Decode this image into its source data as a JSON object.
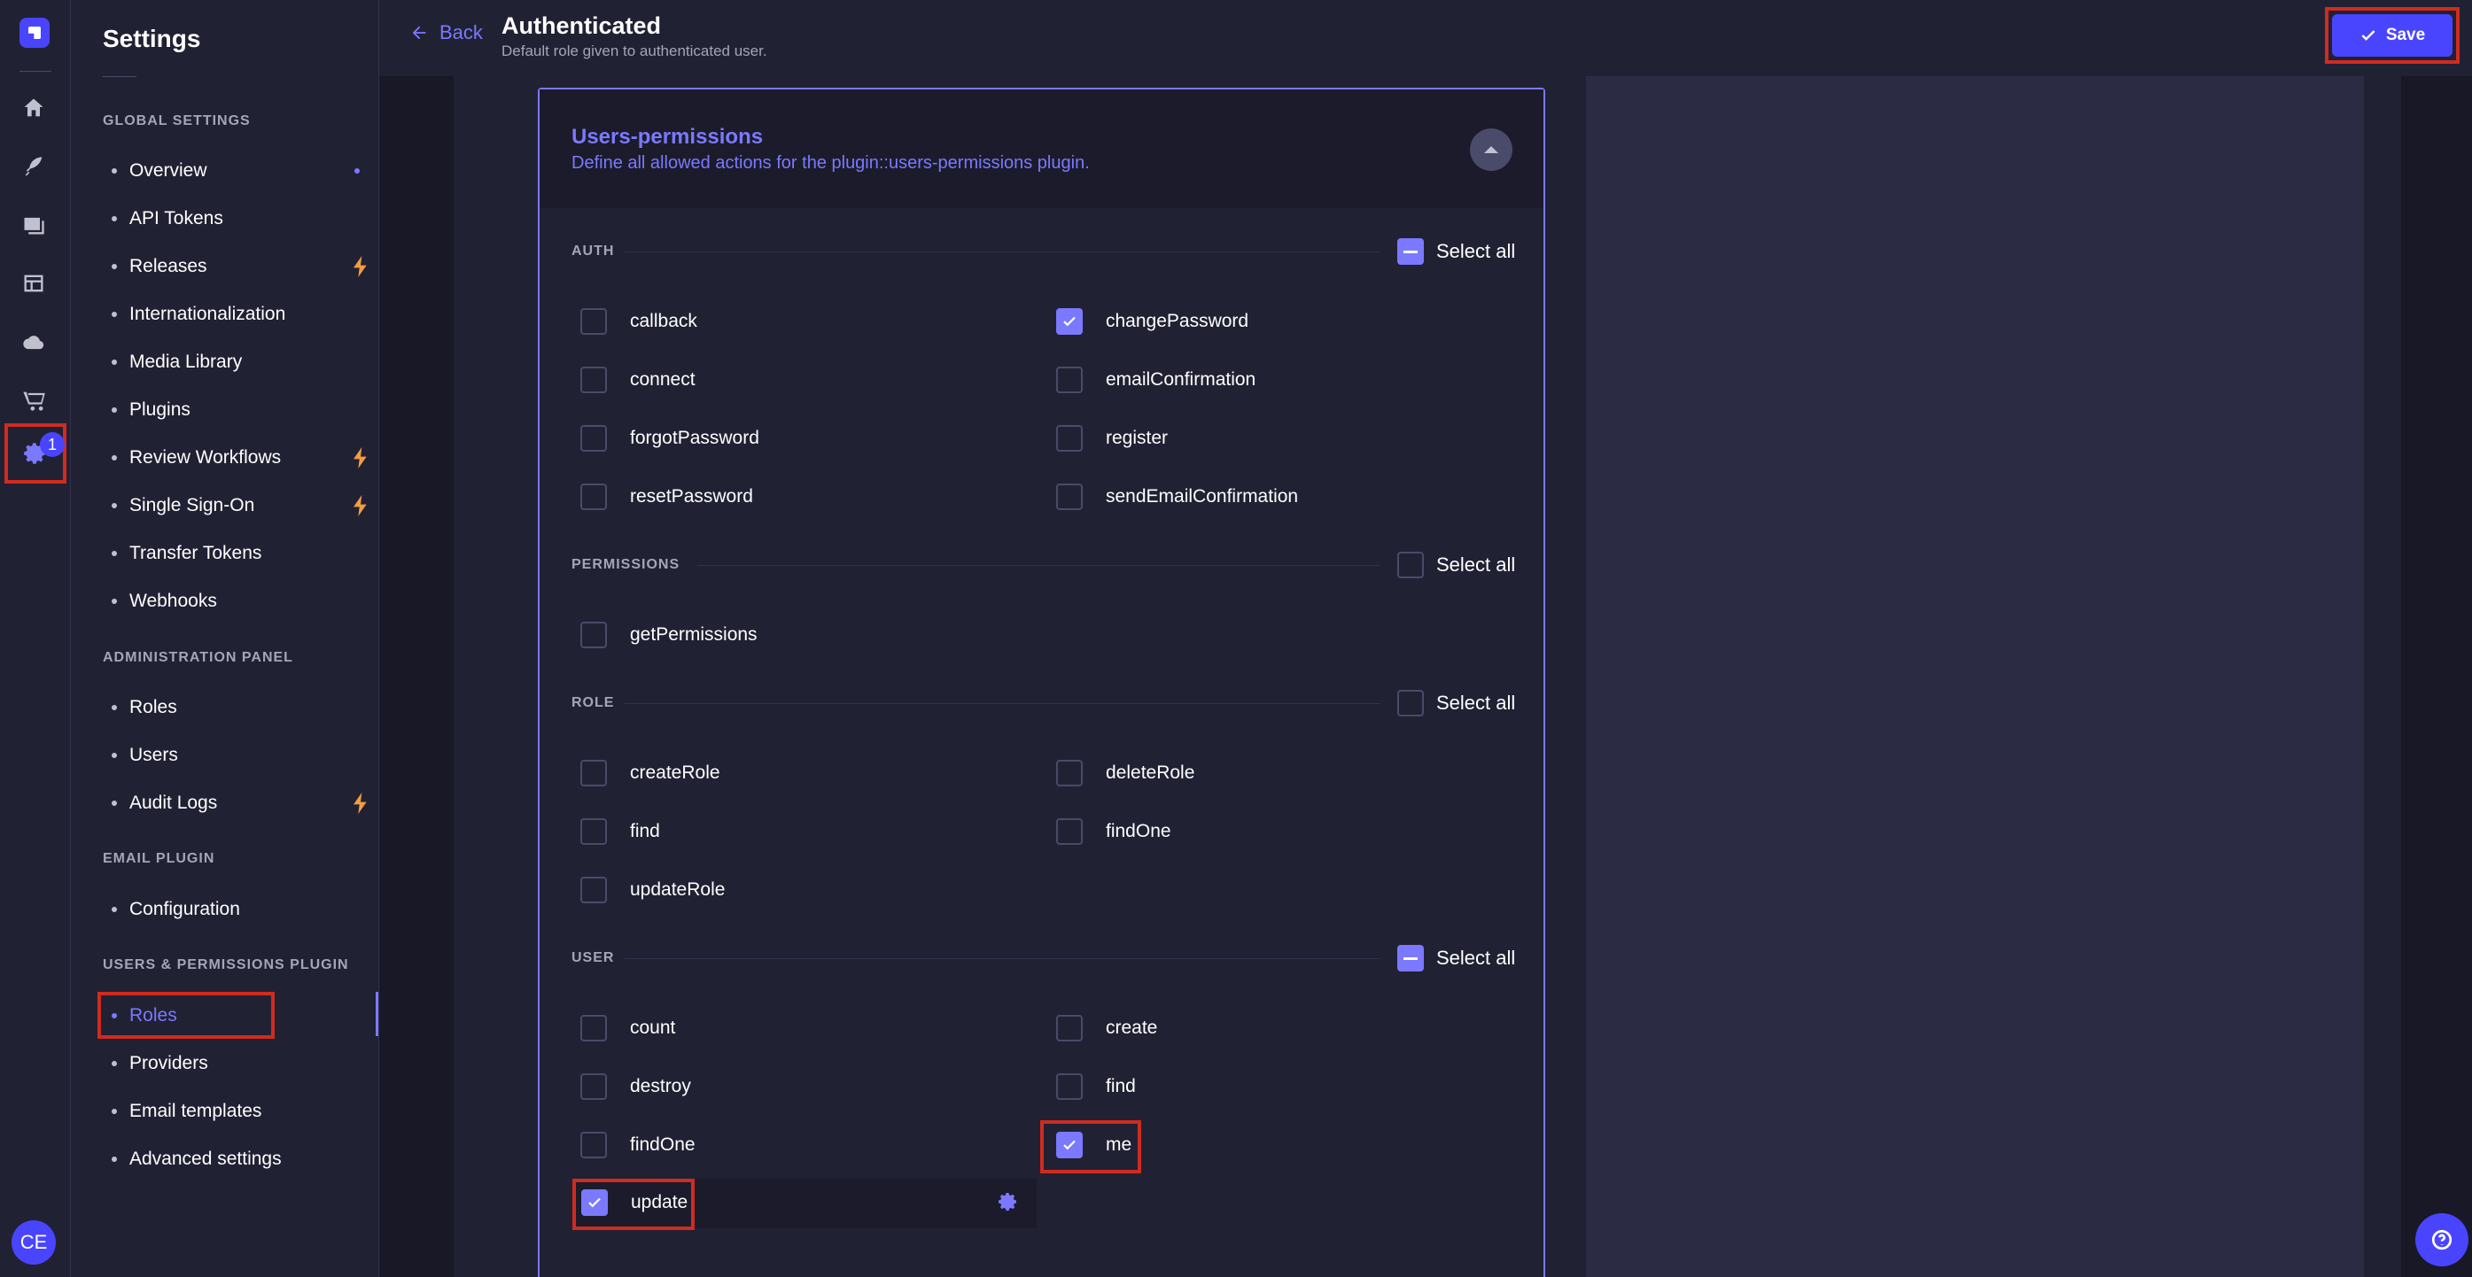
{
  "rail": {
    "logo": "strapi-logo",
    "icons": [
      "home-icon",
      "content-manager-icon",
      "media-library-icon",
      "content-type-builder-icon",
      "cloud-icon",
      "marketplace-icon",
      "settings-icon"
    ],
    "settings_badge": "1",
    "avatar_initials": "CE"
  },
  "subnav": {
    "title": "Settings",
    "sections": [
      {
        "label": "GLOBAL SETTINGS",
        "items": [
          {
            "label": "Overview",
            "indicator": "dot"
          },
          {
            "label": "API Tokens"
          },
          {
            "label": "Releases",
            "indicator": "lightning"
          },
          {
            "label": "Internationalization"
          },
          {
            "label": "Media Library"
          },
          {
            "label": "Plugins"
          },
          {
            "label": "Review Workflows",
            "indicator": "lightning"
          },
          {
            "label": "Single Sign-On",
            "indicator": "lightning"
          },
          {
            "label": "Transfer Tokens"
          },
          {
            "label": "Webhooks"
          }
        ]
      },
      {
        "label": "ADMINISTRATION PANEL",
        "items": [
          {
            "label": "Roles"
          },
          {
            "label": "Users"
          },
          {
            "label": "Audit Logs",
            "indicator": "lightning"
          }
        ]
      },
      {
        "label": "EMAIL PLUGIN",
        "items": [
          {
            "label": "Configuration"
          }
        ]
      },
      {
        "label": "USERS & PERMISSIONS PLUGIN",
        "items": [
          {
            "label": "Roles",
            "active": true
          },
          {
            "label": "Providers"
          },
          {
            "label": "Email templates"
          },
          {
            "label": "Advanced settings"
          }
        ]
      }
    ]
  },
  "header": {
    "back_label": "Back",
    "title": "Authenticated",
    "subtitle": "Default role given to authenticated user.",
    "save_label": "Save"
  },
  "permissions": {
    "title": "Users-permissions",
    "description": "Define all allowed actions for the plugin::users-permissions plugin.",
    "select_all_label": "Select all",
    "groups": [
      {
        "label": "AUTH",
        "select_all_state": "indeterminate",
        "actions": [
          {
            "name": "callback",
            "checked": false
          },
          {
            "name": "changePassword",
            "checked": true
          },
          {
            "name": "connect",
            "checked": false
          },
          {
            "name": "emailConfirmation",
            "checked": false
          },
          {
            "name": "forgotPassword",
            "checked": false
          },
          {
            "name": "register",
            "checked": false
          },
          {
            "name": "resetPassword",
            "checked": false
          },
          {
            "name": "sendEmailConfirmation",
            "checked": false
          }
        ]
      },
      {
        "label": "PERMISSIONS",
        "select_all_state": "unchecked",
        "actions": [
          {
            "name": "getPermissions",
            "checked": false
          }
        ]
      },
      {
        "label": "ROLE",
        "select_all_state": "unchecked",
        "actions": [
          {
            "name": "createRole",
            "checked": false
          },
          {
            "name": "deleteRole",
            "checked": false
          },
          {
            "name": "find",
            "checked": false
          },
          {
            "name": "findOne",
            "checked": false
          },
          {
            "name": "updateRole",
            "checked": false
          }
        ]
      },
      {
        "label": "USER",
        "select_all_state": "indeterminate",
        "actions": [
          {
            "name": "count",
            "checked": false
          },
          {
            "name": "create",
            "checked": false
          },
          {
            "name": "destroy",
            "checked": false
          },
          {
            "name": "find",
            "checked": false
          },
          {
            "name": "findOne",
            "checked": false
          },
          {
            "name": "me",
            "checked": true
          },
          {
            "name": "update",
            "checked": true
          }
        ]
      }
    ]
  },
  "colors": {
    "accent": "#4945ff",
    "accent_light": "#7b79ff",
    "highlight": "#d02b20",
    "lightning": "#f29d41"
  }
}
